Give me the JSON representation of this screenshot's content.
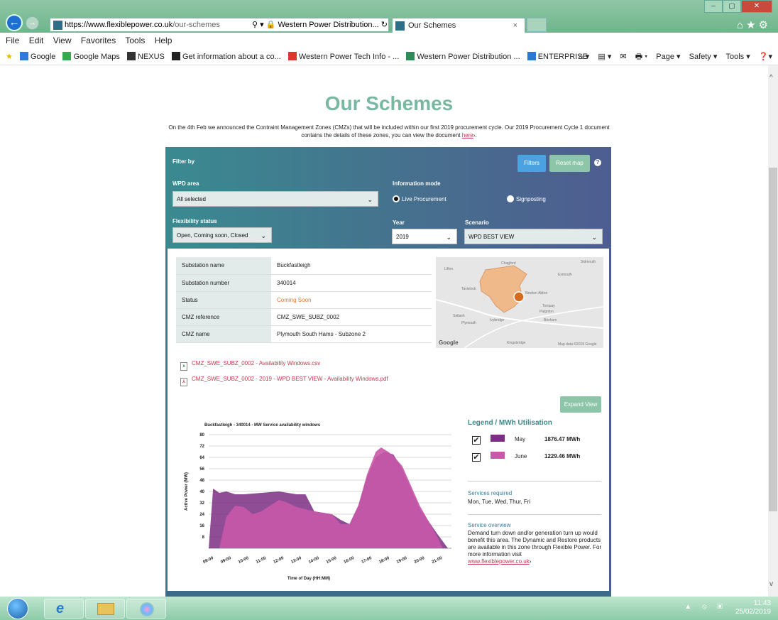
{
  "browser": {
    "url_host": "https://www.flexiblepower.co.uk",
    "url_path": "/our-schemes",
    "search_glyph": "⚲ ▾",
    "security_label": "🔒 Western Power Distribution...",
    "refresh_glyph": "↻",
    "tab_title": "Our Schemes",
    "tab_close": "×",
    "window_min": "–",
    "window_max": "▢",
    "window_close": "✕",
    "toolbar_icons": "⌂★⚙",
    "menu": [
      "File",
      "Edit",
      "View",
      "Favorites",
      "Tools",
      "Help"
    ],
    "favorites": [
      {
        "label": "Google",
        "color": "#2f7ad8"
      },
      {
        "label": "Google Maps",
        "color": "#38a852"
      },
      {
        "label": "NEXUS",
        "color": "#333333"
      },
      {
        "label": "Get information about a co...",
        "color": "#222222"
      },
      {
        "label": "Western Power Tech Info - ...",
        "color": "#d8382e"
      },
      {
        "label": "Western Power Distribution ...",
        "color": "#2f8a5a"
      },
      {
        "label": "ENTERPRISE",
        "color": "#2b7ad0"
      }
    ],
    "commands": [
      "⌂ ▾",
      "▤ ▾",
      "✉",
      "🖶 ▾",
      "Page ▾",
      "Safety ▾",
      "Tools ▾",
      "❓▾"
    ]
  },
  "page": {
    "title": "Our Schemes",
    "intro": "On the 4th Feb we announced the Contraint Management Zones (CMZs) that will be included within our first 2019 procurement cycle.  Our 2019 Procurement Cycle 1 document contains the details of these zones, you can view the document ",
    "intro_link": "here",
    "intro_link_suffix": "›.",
    "filter": {
      "heading": "Filter by",
      "filters_btn": "Filters",
      "reset_btn": "Reset map",
      "help": "?",
      "wpd_area_label": "WPD area",
      "wpd_area_value": "All selected",
      "info_mode_label": "Information mode",
      "mode_live": "Live Procurement",
      "mode_signposting": "Signposting",
      "flex_status_label": "Flexibility status",
      "flex_status_value": "Open, Coming soon, Closed",
      "year_label": "Year",
      "year_value": "2019",
      "scenario_label": "Scenario",
      "scenario_value": "WPD BEST VIEW"
    },
    "details": [
      {
        "k": "Substation name",
        "v": "Buckfastleigh"
      },
      {
        "k": "Substation number",
        "v": "340014"
      },
      {
        "k": "Status",
        "v": "Coming Soon"
      },
      {
        "k": "CMZ reference",
        "v": "CMZ_SWE_SUBZ_0002"
      },
      {
        "k": "CMZ name",
        "v": "Plymouth South Hams - Subzone 2"
      }
    ],
    "map": {
      "places": [
        "Lifton",
        "Chagford",
        "Sidmouth",
        "Exmouth",
        "Tavistock",
        "Newton Abbot",
        "Torquay",
        "Paignton",
        "Saltash",
        "Plymouth",
        "Ivybridge",
        "Brixham",
        "Kingsbridge"
      ],
      "google": "Google",
      "attribution": "Map data ©2019 Google"
    },
    "files": [
      {
        "label": "CMZ_SWE_SUBZ_0002 - Availability Windows.csv",
        "icon": "x",
        "icon_color": "#2e8b3e"
      },
      {
        "label": "CMZ_SWE_SUBZ_0002 - 2019 - WPD BEST VIEW - Availability Windows.pdf",
        "icon": "⅄",
        "icon_color": "#c8374f"
      }
    ],
    "expand_btn": "Expand View",
    "legend": {
      "heading": "Legend / MWh Utilisation",
      "items": [
        {
          "check": "✔",
          "month": "May",
          "value": "1876.47 MWh",
          "color": "#7b2e83"
        },
        {
          "check": "✔",
          "month": "June",
          "value": "1229.46 MWh",
          "color": "#c858a8"
        }
      ]
    },
    "services_required_label": "Services required",
    "services_required": "Mon, Tue, Wed, Thur, Fri",
    "service_overview_label": "Service overview",
    "service_overview": "Demand turn down and/or generation turn up would benefit this area. The Dynamic and Restore products are available in this zone through Flexible Power. For more information visit",
    "service_link": "www.flexiblepower.co.uk",
    "service_link_suffix": "›"
  },
  "chart_data": {
    "type": "area",
    "title": "Buckfastleigh - 340014 - MW Service availability windows",
    "xlabel": "Time of Day (HH:MM)",
    "ylabel": "Active Power (MW)",
    "x": [
      "08:00",
      "09:00",
      "10:00",
      "11:00",
      "12:00",
      "13:00",
      "14:00",
      "15:00",
      "16:00",
      "17:00",
      "18:00",
      "19:00",
      "20:00",
      "21:00"
    ],
    "ylim": [
      0,
      80
    ],
    "yticks": [
      8,
      16,
      24,
      32,
      40,
      48,
      56,
      64,
      72,
      80
    ],
    "grid": true,
    "series": [
      {
        "name": "May",
        "color": "#7b2e83",
        "points": [
          [
            8.0,
            0
          ],
          [
            8.25,
            42
          ],
          [
            8.6,
            39
          ],
          [
            9.0,
            40
          ],
          [
            9.5,
            38
          ],
          [
            10.0,
            38
          ],
          [
            11.0,
            39
          ],
          [
            12.0,
            40
          ],
          [
            13.0,
            38
          ],
          [
            13.5,
            38
          ],
          [
            14.0,
            26
          ],
          [
            15.0,
            24
          ],
          [
            15.5,
            20
          ],
          [
            16.0,
            17
          ],
          [
            16.5,
            30
          ],
          [
            17.0,
            50
          ],
          [
            17.5,
            64
          ],
          [
            18.0,
            68
          ],
          [
            18.5,
            66
          ],
          [
            19.0,
            56
          ],
          [
            20.0,
            28
          ],
          [
            21.0,
            10
          ],
          [
            21.6,
            0
          ]
        ]
      },
      {
        "name": "June",
        "color": "#c858a8",
        "points": [
          [
            8.6,
            0
          ],
          [
            9.0,
            22
          ],
          [
            9.5,
            30
          ],
          [
            10.0,
            29
          ],
          [
            10.5,
            24
          ],
          [
            11.0,
            26
          ],
          [
            12.0,
            34
          ],
          [
            12.5,
            32
          ],
          [
            13.0,
            29
          ],
          [
            14.0,
            26
          ],
          [
            15.0,
            24
          ],
          [
            15.5,
            17
          ],
          [
            16.0,
            17
          ],
          [
            16.5,
            30
          ],
          [
            17.0,
            52
          ],
          [
            17.5,
            68
          ],
          [
            17.8,
            71
          ],
          [
            18.2,
            68
          ],
          [
            18.5,
            65
          ],
          [
            19.0,
            58
          ],
          [
            20.0,
            30
          ],
          [
            21.0,
            8
          ],
          [
            21.3,
            0
          ]
        ]
      }
    ]
  },
  "taskbar": {
    "time": "11:43",
    "date": "25/02/2019",
    "tray": "▲ ⦸ ▣"
  }
}
